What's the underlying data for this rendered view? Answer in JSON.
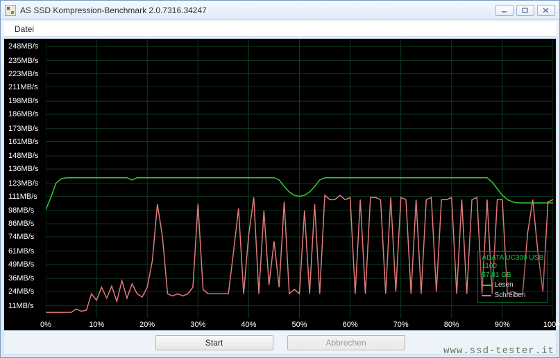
{
  "window": {
    "title": "AS SSD Kompression-Benchmark 2.0.7316.34247"
  },
  "menubar": {
    "datei": "Datei"
  },
  "toolbar": {
    "start_label": "Start",
    "cancel_label": "Abbrechen"
  },
  "watermark": "www.ssd-tester.it",
  "legend": {
    "device": "ADATA UC300 USB",
    "firmware": "1100",
    "capacity": "57,81 GB",
    "read_label": "Lesen",
    "write_label": "Schreiben"
  },
  "chart_data": {
    "type": "line",
    "xlabel": "",
    "ylabel": "",
    "x_unit": "%",
    "y_unit": "MB/s",
    "xlim": [
      0,
      100
    ],
    "ylim": [
      0,
      255
    ],
    "x_ticks": [
      0,
      10,
      20,
      30,
      40,
      50,
      60,
      70,
      80,
      90,
      100
    ],
    "y_ticks": [
      11,
      24,
      36,
      49,
      61,
      74,
      86,
      98,
      111,
      123,
      136,
      148,
      161,
      173,
      186,
      198,
      211,
      223,
      235,
      248
    ],
    "categories_x": [
      0,
      1,
      2,
      3,
      4,
      5,
      6,
      7,
      8,
      9,
      10,
      11,
      12,
      13,
      14,
      15,
      16,
      17,
      18,
      19,
      20,
      21,
      22,
      23,
      24,
      25,
      26,
      27,
      28,
      29,
      30,
      31,
      32,
      33,
      34,
      35,
      36,
      37,
      38,
      39,
      40,
      41,
      42,
      43,
      44,
      45,
      46,
      47,
      48,
      49,
      50,
      51,
      52,
      53,
      54,
      55,
      56,
      57,
      58,
      59,
      60,
      61,
      62,
      63,
      64,
      65,
      66,
      67,
      68,
      69,
      70,
      71,
      72,
      73,
      74,
      75,
      76,
      77,
      78,
      79,
      80,
      81,
      82,
      83,
      84,
      85,
      86,
      87,
      88,
      89,
      90,
      91,
      92,
      93,
      94,
      95,
      96,
      97,
      98,
      99,
      100
    ],
    "series": [
      {
        "name": "Lesen",
        "color": "#2fce2f",
        "values": [
          99,
          110,
          123,
          127,
          128,
          128,
          128,
          128,
          128,
          128,
          128,
          128,
          128,
          128,
          128,
          128,
          128,
          126,
          128,
          128,
          128,
          128,
          128,
          128,
          128,
          128,
          128,
          128,
          128,
          128,
          128,
          128,
          128,
          128,
          128,
          128,
          128,
          128,
          128,
          128,
          128,
          128,
          128,
          128,
          128,
          128,
          126,
          120,
          115,
          112,
          111,
          112,
          115,
          120,
          126,
          128,
          128,
          128,
          128,
          128,
          128,
          128,
          128,
          128,
          128,
          128,
          128,
          128,
          128,
          128,
          128,
          128,
          128,
          128,
          128,
          128,
          128,
          128,
          128,
          128,
          128,
          128,
          128,
          128,
          128,
          128,
          128,
          128,
          124,
          118,
          112,
          108,
          106,
          105,
          105,
          105,
          105,
          105,
          105,
          105,
          105
        ]
      },
      {
        "name": "Schreiben",
        "color": "#e07a7a",
        "values": [
          5,
          5,
          5,
          5,
          5,
          5,
          8,
          6,
          7,
          22,
          16,
          28,
          18,
          29,
          15,
          34,
          18,
          31,
          22,
          19,
          28,
          52,
          104,
          74,
          22,
          20,
          22,
          20,
          22,
          28,
          104,
          26,
          22,
          22,
          22,
          22,
          22,
          60,
          100,
          22,
          76,
          110,
          22,
          98,
          30,
          70,
          28,
          106,
          22,
          26,
          22,
          98,
          22,
          104,
          22,
          112,
          108,
          108,
          112,
          108,
          110,
          22,
          108,
          22,
          110,
          110,
          108,
          22,
          110,
          24,
          110,
          108,
          22,
          108,
          22,
          108,
          110,
          24,
          108,
          108,
          110,
          22,
          108,
          22,
          108,
          110,
          22,
          108,
          22,
          108,
          108,
          22,
          24,
          22,
          22,
          78,
          108,
          60,
          24,
          106,
          108
        ]
      }
    ]
  }
}
